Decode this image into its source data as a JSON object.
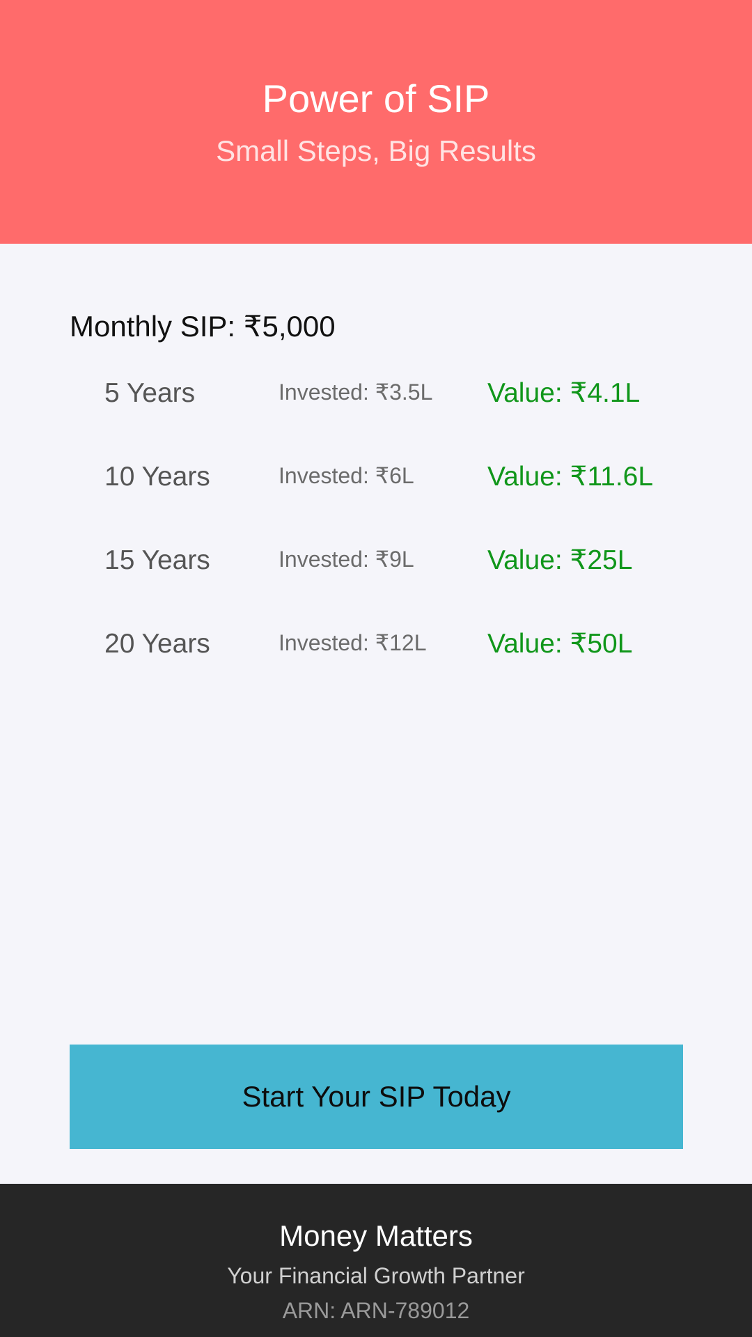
{
  "header": {
    "title": "Power of SIP",
    "subtitle": "Small Steps, Big Results"
  },
  "main": {
    "monthly_sip": "Monthly SIP: ₹5,000",
    "projections": [
      {
        "years": "5 Years",
        "invested": "Invested: ₹3.5L",
        "value": "Value: ₹4.1L"
      },
      {
        "years": "10 Years",
        "invested": "Invested: ₹6L",
        "value": "Value: ₹11.6L"
      },
      {
        "years": "15 Years",
        "invested": "Invested: ₹9L",
        "value": "Value: ₹25L"
      },
      {
        "years": "20 Years",
        "invested": "Invested: ₹12L",
        "value": "Value: ₹50L"
      }
    ],
    "cta_label": "Start Your SIP Today"
  },
  "footer": {
    "brand": "Money Matters",
    "tagline": "Your Financial Growth Partner",
    "arn": "ARN: ARN-789012"
  },
  "colors": {
    "header_bg": "#ff6b6b",
    "page_bg": "#f5f5fa",
    "value_green": "#10961a",
    "cta_bg": "#46b6d1",
    "footer_bg": "#262626"
  }
}
